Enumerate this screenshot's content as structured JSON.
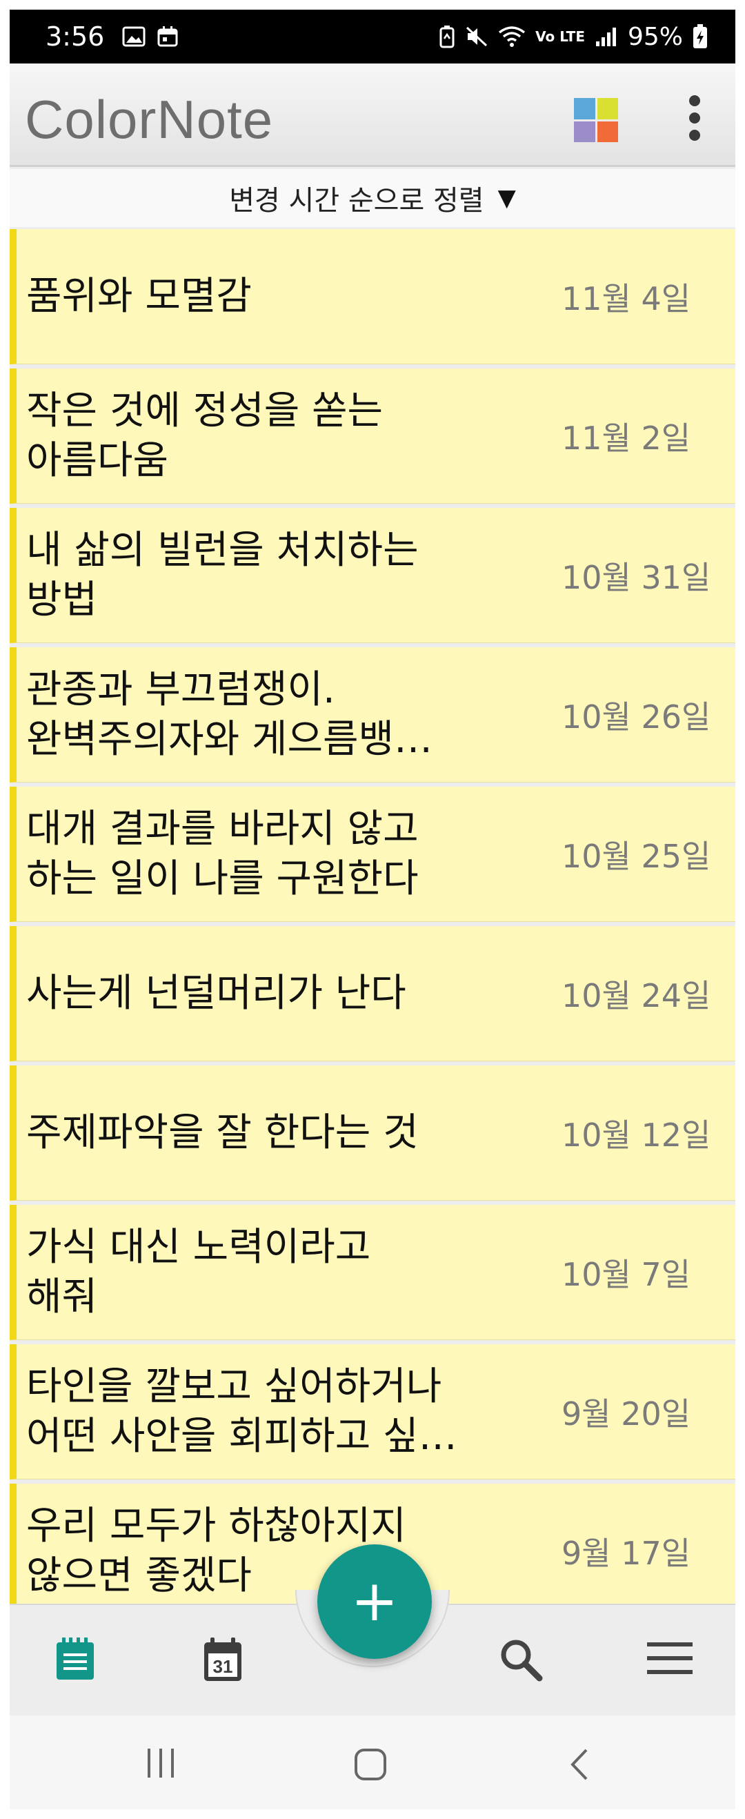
{
  "status_bar": {
    "time": "3:56",
    "network": "Vo LTE",
    "battery": "95%"
  },
  "app": {
    "logo_text": "ColorNote",
    "color_squares": [
      "#5aa7d8",
      "#d9e031",
      "#9b8ec8",
      "#f06b37"
    ]
  },
  "sort": {
    "label": "변경 시간 순으로 정렬",
    "arrow": "▼"
  },
  "notes": [
    {
      "title": "품위와 모멸감",
      "date": "11월 4일"
    },
    {
      "title": "작은 것에 정성을 쏟는\n아름다움",
      "date": "11월 2일"
    },
    {
      "title": "내 삶의 빌런을 처치하는\n방법",
      "date": "10월 31일"
    },
    {
      "title": "관종과 부끄럼쟁이.\n완벽주의자와 게으름뱅…",
      "date": "10월 26일"
    },
    {
      "title": "대개 결과를 바라지 않고\n하는 일이 나를 구원한다",
      "date": "10월 25일"
    },
    {
      "title": "사는게 넌덜머리가 난다",
      "date": "10월 24일"
    },
    {
      "title": "주제파악을 잘 한다는 것",
      "date": "10월 12일"
    },
    {
      "title": "가식 대신 노력이라고\n해줘",
      "date": "10월 7일"
    },
    {
      "title": "타인을 깔보고 싶어하거나\n어떤 사안을 회피하고 싶…",
      "date": "9월 20일"
    },
    {
      "title": "우리 모두가 하찮아지지\n않으면 좋겠다",
      "date": "9월 17일"
    }
  ],
  "note_colors": {
    "background": "#fff8bb",
    "stripe": "#f2d816"
  },
  "bottom_nav": {
    "calendar_day": "31",
    "fab_symbol": "+",
    "accent": "#12968a",
    "icons": [
      "notes-list-icon",
      "calendar-icon",
      "add-icon",
      "search-icon",
      "menu-icon"
    ]
  }
}
